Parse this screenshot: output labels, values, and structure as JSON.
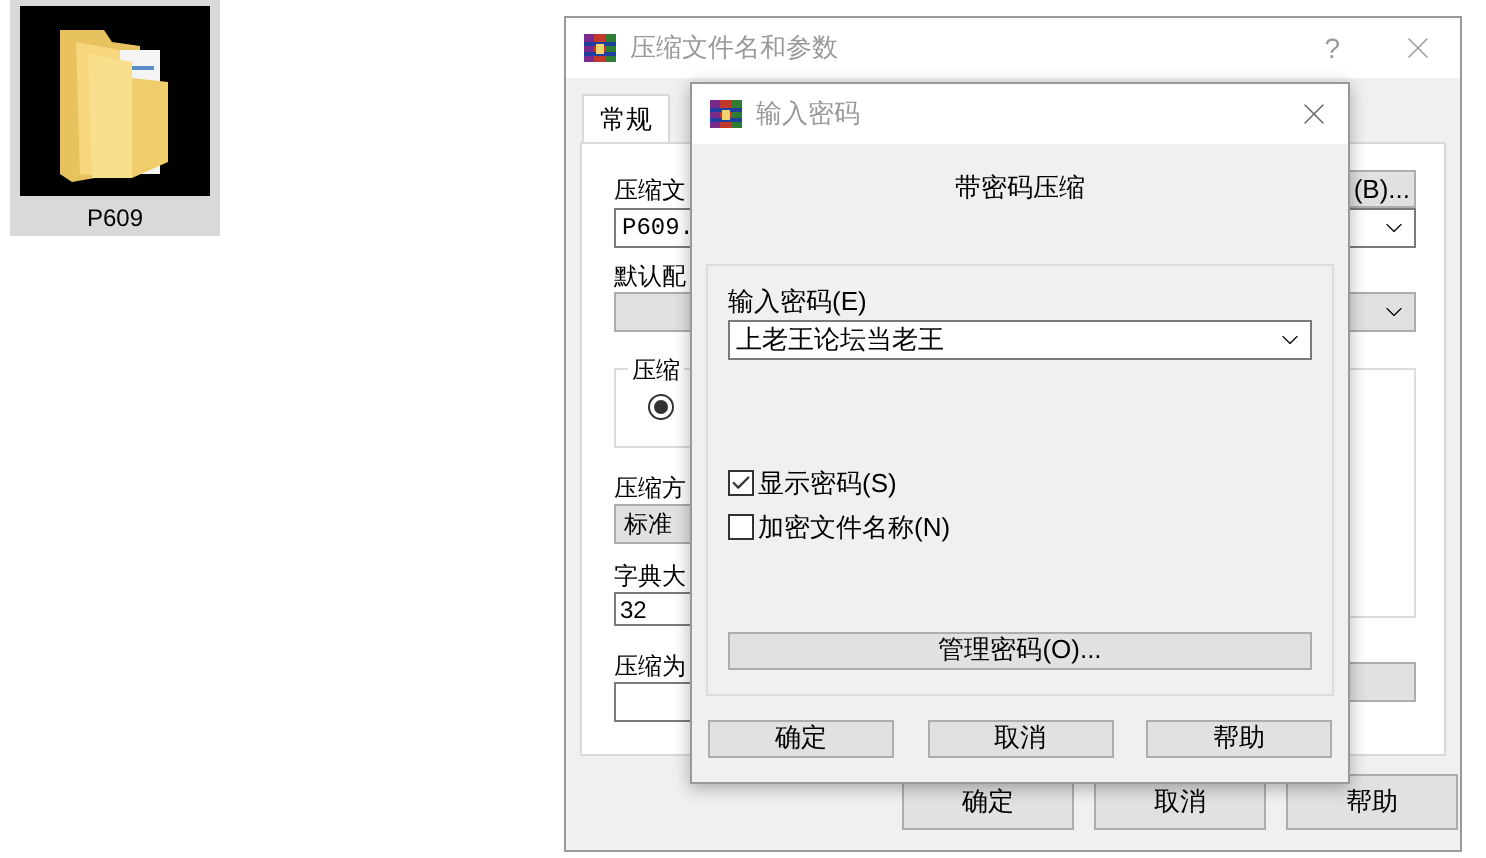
{
  "desktop_icon": {
    "label": "P609",
    "selected": true
  },
  "back_window": {
    "title": "压缩文件名和参数",
    "help": "?",
    "tabs": [
      {
        "label": "常规",
        "selected": true
      }
    ],
    "archive_name": {
      "label": "压缩文",
      "value": "P609."
    },
    "browse_button": "(B)...",
    "profile": {
      "label": "默认配"
    },
    "group": {
      "label": "压缩",
      "radio_selected": true
    },
    "method": {
      "label": "压缩方",
      "value": "标准"
    },
    "dictionary": {
      "label": "字典大",
      "value": "32"
    },
    "split": {
      "label": "压缩为"
    },
    "buttons": [
      "确定",
      "取消",
      "帮助"
    ]
  },
  "dialog": {
    "title": "输入密码",
    "heading": "带密码压缩",
    "password": {
      "label": "输入密码(E)",
      "value": "上老王论坛当老王"
    },
    "checkboxes": [
      {
        "label": "显示密码(S)",
        "checked": true
      },
      {
        "label": "加密文件名称(N)",
        "checked": false
      }
    ],
    "manage_button": "管理密码(O)...",
    "buttons": [
      "确定",
      "取消",
      "帮助"
    ]
  }
}
